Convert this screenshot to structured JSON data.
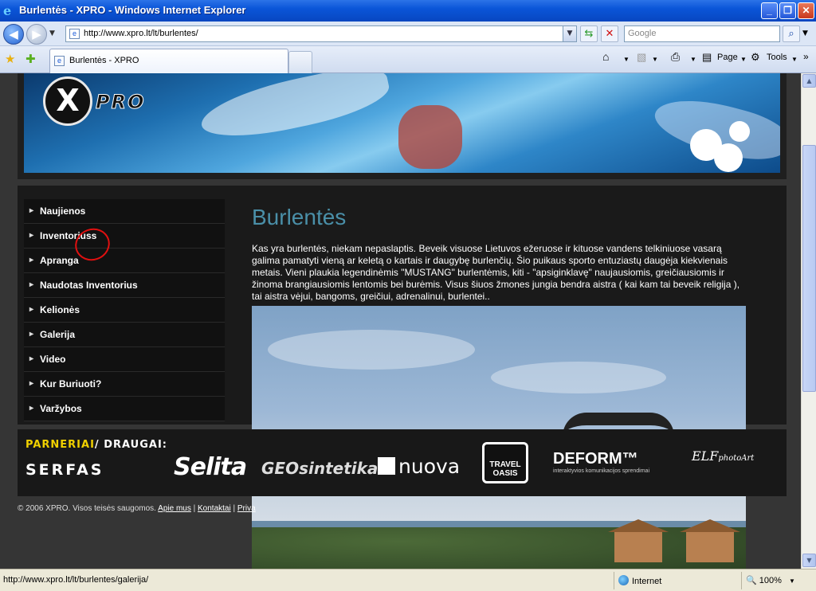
{
  "window": {
    "title": "Burlentės - XPRO - Windows Internet Explorer",
    "minimize": "_",
    "restore": "❐",
    "close": "✕"
  },
  "addressbar": {
    "url": "http://www.xpro.lt/lt/burlentes/",
    "search_placeholder": "Google"
  },
  "tabs": [
    {
      "label": "Burlentės - XPRO"
    }
  ],
  "commandbar": {
    "page": "Page",
    "tools": "Tools"
  },
  "site": {
    "logo_letter": "X",
    "logo_text": "PRO",
    "menu": [
      {
        "label": "Naujienos"
      },
      {
        "label": "Inventoriuss"
      },
      {
        "label": "Apranga"
      },
      {
        "label": "Naudotas Inventorius"
      },
      {
        "label": "Kelionės"
      },
      {
        "label": "Galerija"
      },
      {
        "label": "Video"
      },
      {
        "label": "Kur Buriuoti?"
      },
      {
        "label": "Varžybos"
      }
    ],
    "page_title": "Burlentės",
    "intro": "Kas yra burlentės, niekam nepaslaptis.  Beveik visuose Lietuvos ežeruose ir kituose vandens telkiniuose vasarą galima pamatyti vieną ar keletą o kartais ir daugybę burlenčių. Šio puikaus sporto entuziastų daugėja kiekvienais metais. Vieni plaukia legendinėmis \"MUSTANG\" burlentėmis, kiti - \"apsiginklavę\" naujausiomis, greičiausiomis ir žinoma brangiausiomis lentomis bei burėmis. Visus šiuos žmones jungia bendra aistra ( kai kam tai beveik religija ), tai aistra vėjui, bangoms, greičiui, adrenalinui, burlentei..",
    "partners_title_a": "PARNERIAI",
    "partners_title_b": "/ DRAUGAI:",
    "partners": {
      "serfas": "SERFAS",
      "selita": "Selita",
      "geo": "GEOsintetika",
      "nuova": "nuova",
      "travel_line1": "TRAVEL",
      "travel_line2": "OASIS",
      "deform": "DEFORM™",
      "deform_sub": "interaktyvios komunikacijos sprendimai",
      "elf": "ELF",
      "elf_sub": "photoArt"
    },
    "footer": {
      "copyright": "© 2006 XPRO. Visos teisės saugomos.",
      "links": [
        "Apie mus",
        "Kontaktai",
        "Priva"
      ]
    }
  },
  "statusbar": {
    "url": "http://www.xpro.lt/lt/burlentes/galerija/",
    "zone": "Internet",
    "zoom": "100%"
  },
  "colors": {
    "title_accent": "#4a8fa8",
    "partners_accent": "#f0d000",
    "annotation": "#e01010"
  }
}
